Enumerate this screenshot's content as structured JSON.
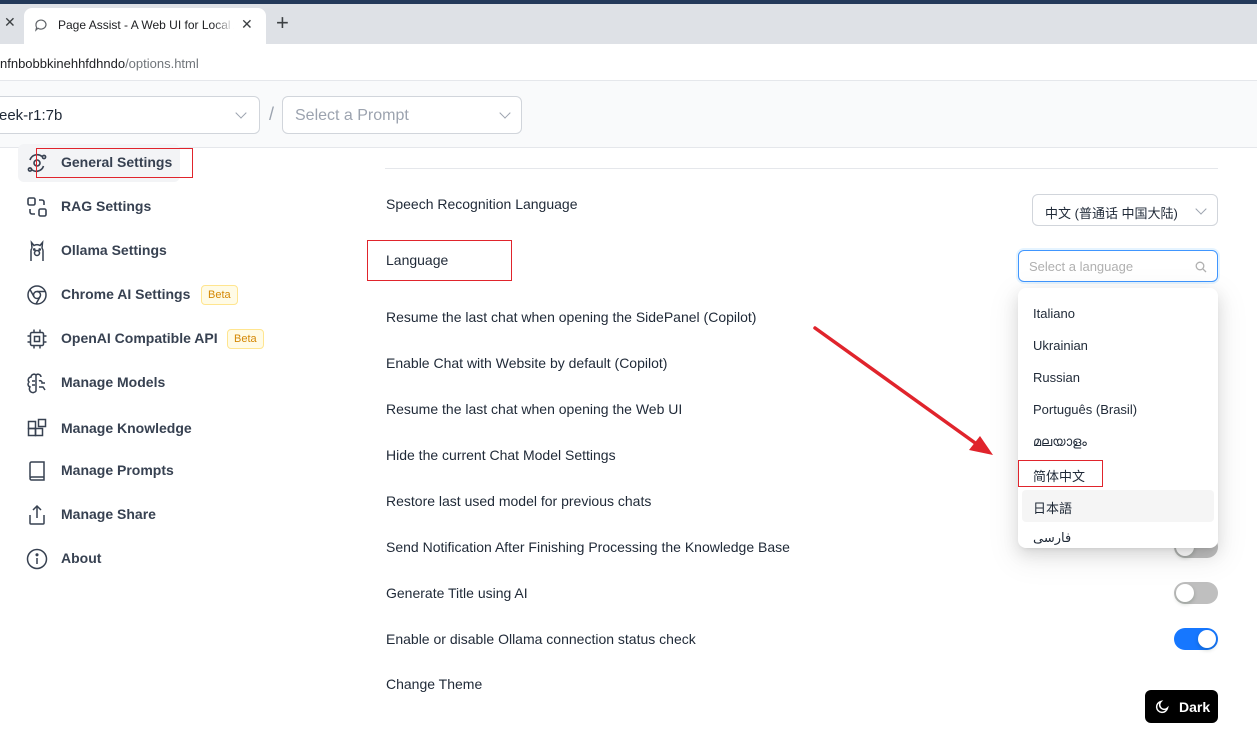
{
  "browser": {
    "tab_title": "Page Assist - A Web UI for Local AI",
    "new_tab_symbol": "+",
    "close_symbol": "✕",
    "address_host": "nfnbobbkinehhfdhndo",
    "address_path": "/options.html"
  },
  "header": {
    "model_value": "eek-r1:7b",
    "separator": "/",
    "prompt_placeholder": "Select a Prompt"
  },
  "sidebar": {
    "items": [
      {
        "label": "General Settings",
        "icon": "orbit-icon",
        "active": true
      },
      {
        "label": "RAG Settings",
        "icon": "combine-icon"
      },
      {
        "label": "Ollama Settings",
        "icon": "llama-icon"
      },
      {
        "label": "Chrome AI Settings",
        "icon": "chrome-icon",
        "badge": "Beta"
      },
      {
        "label": "OpenAI Compatible API",
        "icon": "cpu-icon",
        "badge": "Beta"
      },
      {
        "label": "Manage Models",
        "icon": "brain-icon"
      },
      {
        "label": "Manage Knowledge",
        "icon": "blocks-icon"
      },
      {
        "label": "Manage Prompts",
        "icon": "book-icon"
      },
      {
        "label": "Manage Share",
        "icon": "share-icon"
      },
      {
        "label": "About",
        "icon": "info-icon"
      }
    ]
  },
  "settings": {
    "speech_label": "Speech Recognition Language",
    "speech_value": "中文 (普通话 中国大陆)",
    "language_label": "Language",
    "language_placeholder": "Select a language",
    "rows": [
      {
        "label": "Resume the last chat when opening the SidePanel (Copilot)"
      },
      {
        "label": "Enable Chat with Website by default (Copilot)"
      },
      {
        "label": "Resume the last chat when opening the Web UI"
      },
      {
        "label": "Hide the current Chat Model Settings"
      },
      {
        "label": "Restore last used model for previous chats"
      },
      {
        "label": "Send Notification After Finishing Processing the Knowledge Base",
        "toggle": "off"
      },
      {
        "label": "Generate Title using AI",
        "toggle": "off"
      },
      {
        "label": "Enable or disable Ollama connection status check",
        "toggle": "on"
      }
    ],
    "theme_label": "Change Theme",
    "theme_button": "Dark"
  },
  "language_dropdown": {
    "options": [
      "Italiano",
      "Ukrainian",
      "Russian",
      "Português (Brasil)",
      "മലയാളം",
      "简体中文",
      "日本語",
      "فارسی"
    ],
    "hovered": "日本語",
    "annotated": "简体中文"
  },
  "colors": {
    "annotation_red": "#e0242c",
    "toggle_on": "#1677ff",
    "toggle_off": "#bfbfbf",
    "focus_border": "#4096ff"
  }
}
